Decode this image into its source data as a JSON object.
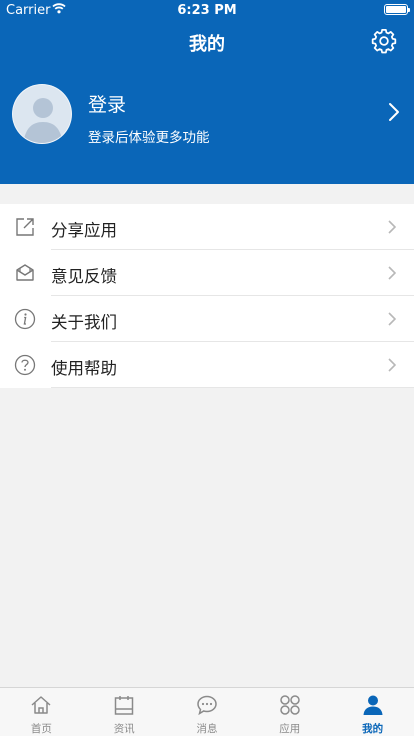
{
  "status_bar": {
    "carrier": "Carrier",
    "time": "6:23 PM"
  },
  "nav": {
    "title": "我的",
    "settings_icon": "gear-icon"
  },
  "profile": {
    "title": "登录",
    "subtitle": "登录后体验更多功能",
    "avatar_icon": "user-avatar-icon"
  },
  "menu": [
    {
      "label": "分享应用",
      "icon": "share-icon"
    },
    {
      "label": "意见反馈",
      "icon": "feedback-mail-icon"
    },
    {
      "label": "关于我们",
      "icon": "info-icon"
    },
    {
      "label": "使用帮助",
      "icon": "help-icon"
    }
  ],
  "tabs": [
    {
      "label": "首页",
      "icon": "home-icon"
    },
    {
      "label": "资讯",
      "icon": "calendar-news-icon"
    },
    {
      "label": "消息",
      "icon": "message-icon"
    },
    {
      "label": "应用",
      "icon": "apps-icon"
    },
    {
      "label": "我的",
      "icon": "person-icon",
      "active": true
    }
  ],
  "colors": {
    "brand": "#0a66b8",
    "background": "#f2f2f2",
    "inactive": "#8a8a8a"
  }
}
